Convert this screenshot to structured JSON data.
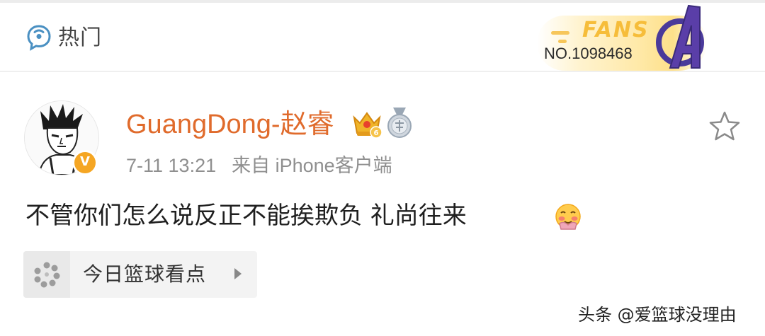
{
  "header": {
    "hot_label": "热门",
    "fans_badge": {
      "fans_text": "FANS",
      "number": "NO.1098468"
    }
  },
  "post": {
    "username": "GuangDong-赵睿",
    "time": "7-11 13:21",
    "source": "来自 iPhone客户端",
    "verified_mark": "V",
    "content": "不管你们怎么说反正不能挨欺负 礼尚往来",
    "topic_card": {
      "label": "今日篮球看点"
    }
  },
  "watermark": "头条 @爱篮球没理由",
  "colors": {
    "username": "#e06b2c",
    "meta": "#8f8f8f",
    "fans_gold": "#f6bd3a",
    "verified": "#f5a623"
  },
  "icons": [
    "hot-topic-icon",
    "avengers-logo-icon",
    "crown-vip-icon",
    "medal-icon",
    "favorite-star-icon",
    "blush-emoji-icon",
    "topic-pinwheel-icon",
    "chevron-right-icon"
  ]
}
